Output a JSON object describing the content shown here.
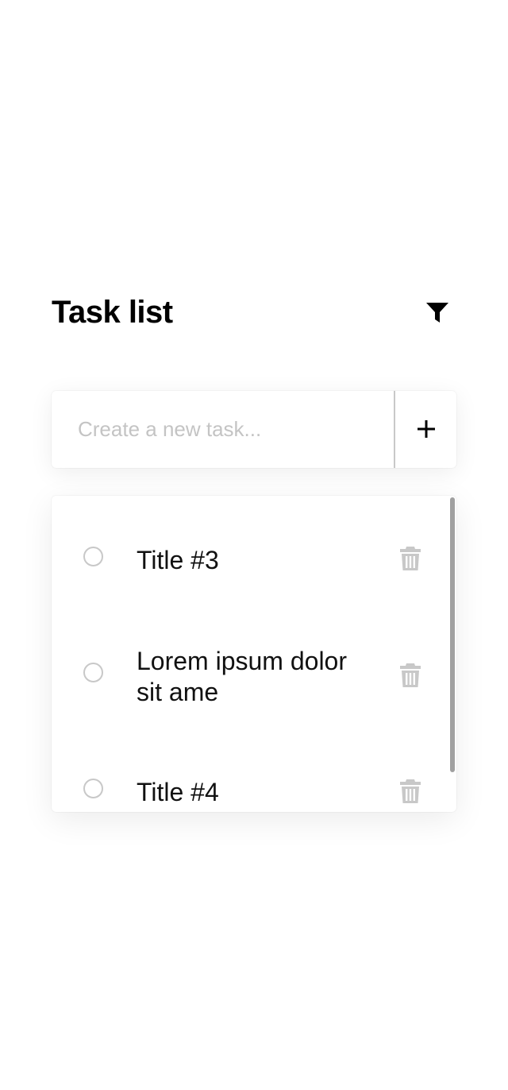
{
  "header": {
    "title": "Task list",
    "filter_icon": "filter-icon"
  },
  "new_task": {
    "placeholder": "Create a new task...",
    "value": "",
    "add_icon": "plus-icon"
  },
  "tasks": [
    {
      "title": "Title #3",
      "completed": false
    },
    {
      "title": "Lorem ipsum dolor sit ame",
      "completed": false
    },
    {
      "title": "Title #4",
      "completed": false
    }
  ],
  "colors": {
    "text": "#000000",
    "placeholder": "#c4c4c4",
    "muted_icon": "#c8c8c8",
    "scrollbar": "#a0a0a0",
    "background": "#ffffff"
  }
}
